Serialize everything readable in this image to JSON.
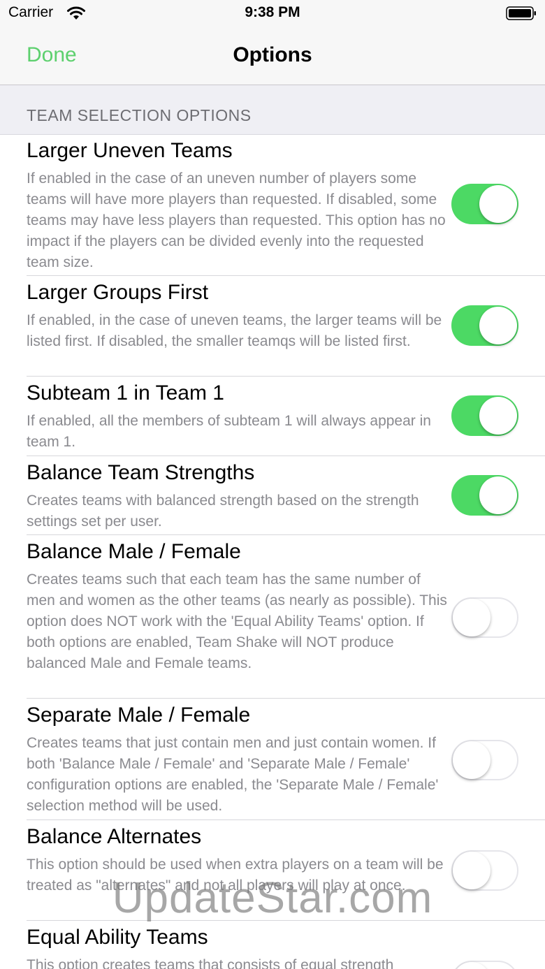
{
  "status_bar": {
    "carrier": "Carrier",
    "time": "9:38 PM"
  },
  "nav": {
    "done_label": "Done",
    "title": "Options"
  },
  "section": {
    "header": "TEAM SELECTION OPTIONS"
  },
  "options": [
    {
      "title": "Larger Uneven Teams",
      "description": "If enabled in the case of an uneven number of players some teams will have more players than requested.  If disabled, some teams may have less players than requested.  This option has no impact if the players can be divided evenly into the requested team size.",
      "enabled": true
    },
    {
      "title": "Larger Groups First",
      "description": "If enabled, in the case of uneven teams, the larger teams will be listed first.  If disabled, the smaller teamqs will be listed first.",
      "enabled": true
    },
    {
      "title": "Subteam 1 in Team 1",
      "description": "If enabled, all the members of subteam 1 will always appear in team 1.",
      "enabled": true
    },
    {
      "title": "Balance Team Strengths",
      "description": "Creates teams with balanced strength based on the strength settings set per user.",
      "enabled": true
    },
    {
      "title": "Balance Male / Female",
      "description": "Creates teams such that each team has the same number of men and women as the other teams (as nearly as possible). This option does NOT work with the 'Equal Ability Teams' option.  If both options are enabled, Team Shake will NOT produce balanced Male and Female teams.",
      "enabled": false
    },
    {
      "title": "Separate Male / Female",
      "description": "Creates teams that just contain men and just contain women. If both 'Balance Male / Female' and 'Separate Male / Female' configuration options are enabled, the 'Separate Male / Female' selection method will be used.",
      "enabled": false
    },
    {
      "title": "Balance Alternates",
      "description": "This option should be used when extra players on a team will be treated as \"alternates\" and not all players will play at once.",
      "enabled": false
    },
    {
      "title": "Equal Ability Teams",
      "description": "This option creates teams that consists of equal strength",
      "enabled": false
    }
  ],
  "watermark": "UpdateStar.com",
  "colors": {
    "accent": "#5dd06e",
    "toggle_on": "#4cd964",
    "background": "#efeff4"
  }
}
